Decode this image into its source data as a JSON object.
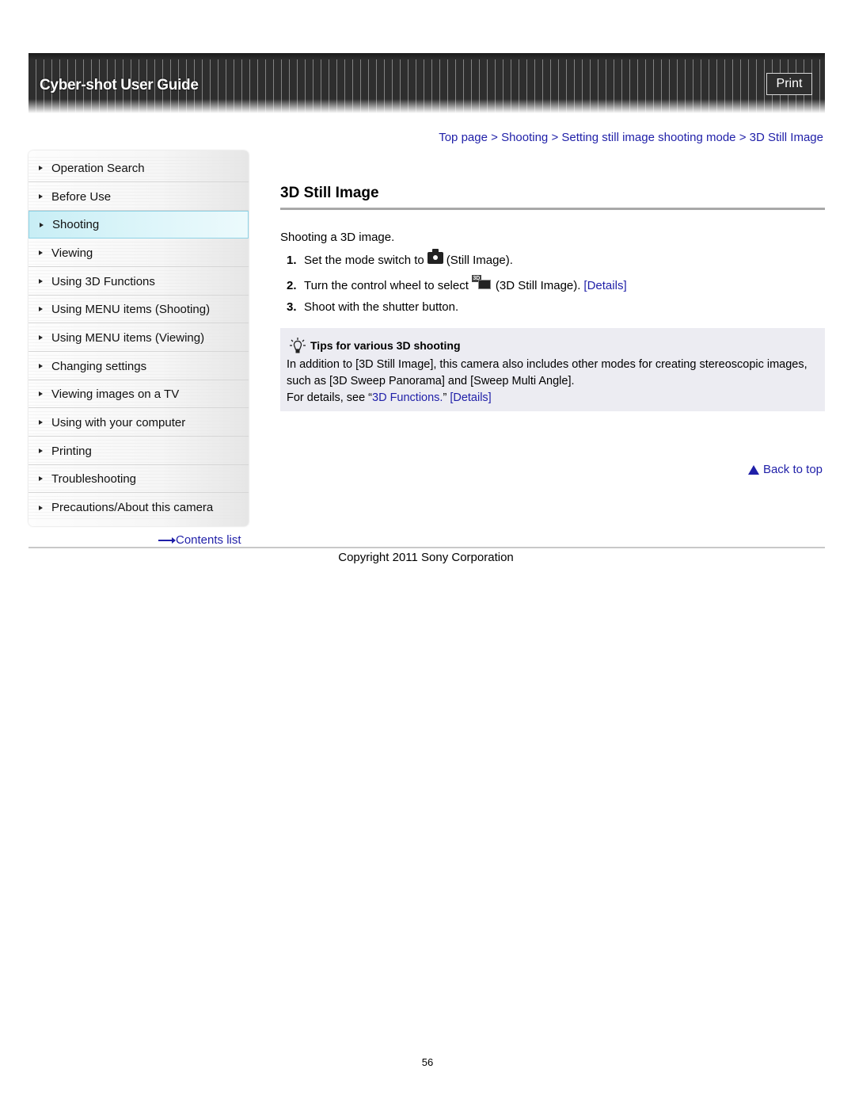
{
  "header": {
    "title": "Cyber-shot User Guide",
    "print_label": "Print"
  },
  "sidebar": {
    "items": [
      {
        "label": "Operation Search",
        "active": false
      },
      {
        "label": "Before Use",
        "active": false
      },
      {
        "label": "Shooting",
        "active": true
      },
      {
        "label": "Viewing",
        "active": false
      },
      {
        "label": "Using 3D Functions",
        "active": false
      },
      {
        "label": "Using MENU items (Shooting)",
        "active": false
      },
      {
        "label": "Using MENU items (Viewing)",
        "active": false
      },
      {
        "label": "Changing settings",
        "active": false
      },
      {
        "label": "Viewing images on a TV",
        "active": false
      },
      {
        "label": "Using with your computer",
        "active": false
      },
      {
        "label": "Printing",
        "active": false
      },
      {
        "label": "Troubleshooting",
        "active": false
      },
      {
        "label": "Precautions/About this camera",
        "active": false
      }
    ],
    "contents_link": "Contents list"
  },
  "breadcrumb": {
    "items": [
      "Top page",
      "Shooting",
      "Setting still image shooting mode",
      "3D Still Image"
    ],
    "separator": ">"
  },
  "main": {
    "title": "3D Still Image",
    "intro": "Shooting a 3D image.",
    "steps": [
      {
        "num": "1.",
        "before": "Set the mode switch to",
        "icon": "camera-icon",
        "after": "(Still Image).",
        "link": ""
      },
      {
        "num": "2.",
        "before": "Turn the control wheel to select",
        "icon": "3d-still-image-icon",
        "after": "(3D Still Image).",
        "link": "[Details]"
      },
      {
        "num": "3.",
        "before": "Shoot with the shutter button.",
        "icon": "",
        "after": "",
        "link": ""
      }
    ],
    "tips": {
      "heading": "Tips for various 3D shooting",
      "icon": "lightbulb-icon",
      "line1": "In addition to [3D Still Image], this camera also includes other modes for creating stereoscopic images, such as [3D Sweep Panorama] and [Sweep Multi Angle].",
      "line2_before": "For details, see “",
      "line2_link": "3D Functions.",
      "line2_after": "” ",
      "line2_details": "[Details]"
    },
    "back_to_top": "Back to top"
  },
  "footer": {
    "copyright": "Copyright 2011 Sony Corporation",
    "page_number": "56"
  },
  "colors": {
    "link": "#1f1fa8",
    "header_bg": "#2e2e2e",
    "tips_bg": "#ececf2",
    "active_item": "#c8eef5"
  }
}
